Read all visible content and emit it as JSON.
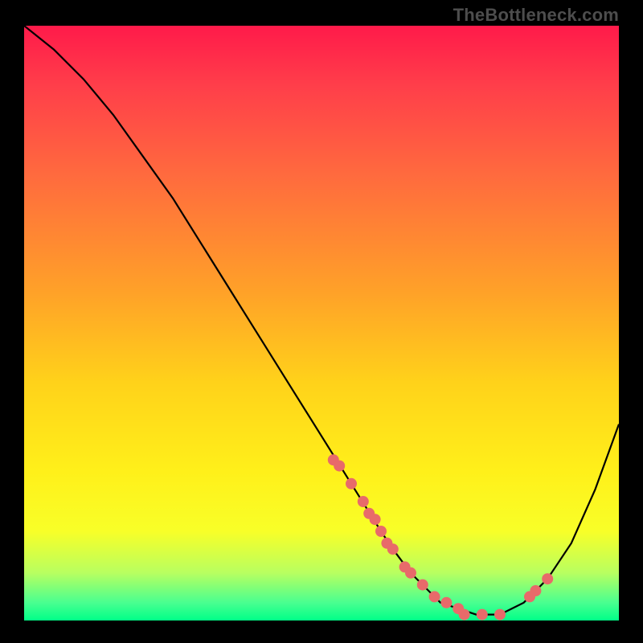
{
  "watermark": "TheBottleneck.com",
  "chart_data": {
    "type": "line",
    "title": "",
    "xlabel": "",
    "ylabel": "",
    "xlim": [
      0,
      100
    ],
    "ylim": [
      0,
      100
    ],
    "grid": false,
    "series": [
      {
        "name": "curve",
        "x": [
          0,
          5,
          10,
          15,
          20,
          25,
          30,
          35,
          40,
          45,
          50,
          55,
          60,
          62,
          65,
          68,
          70,
          73,
          76,
          80,
          84,
          88,
          92,
          96,
          100
        ],
        "y": [
          100,
          96,
          91,
          85,
          78,
          71,
          63,
          55,
          47,
          39,
          31,
          23,
          15,
          12,
          8,
          5,
          3,
          2,
          1,
          1,
          3,
          7,
          13,
          22,
          33
        ]
      }
    ],
    "points": {
      "name": "markers",
      "x": [
        52,
        53,
        55,
        57,
        58,
        59,
        60,
        61,
        62,
        64,
        65,
        67,
        69,
        71,
        73,
        74,
        77,
        80,
        85,
        86,
        88
      ],
      "y": [
        27,
        26,
        23,
        20,
        18,
        17,
        15,
        13,
        12,
        9,
        8,
        6,
        4,
        3,
        2,
        1,
        1,
        1,
        4,
        5,
        7
      ]
    },
    "colors": {
      "curve": "#000000",
      "marker": "#e86a6a"
    }
  }
}
